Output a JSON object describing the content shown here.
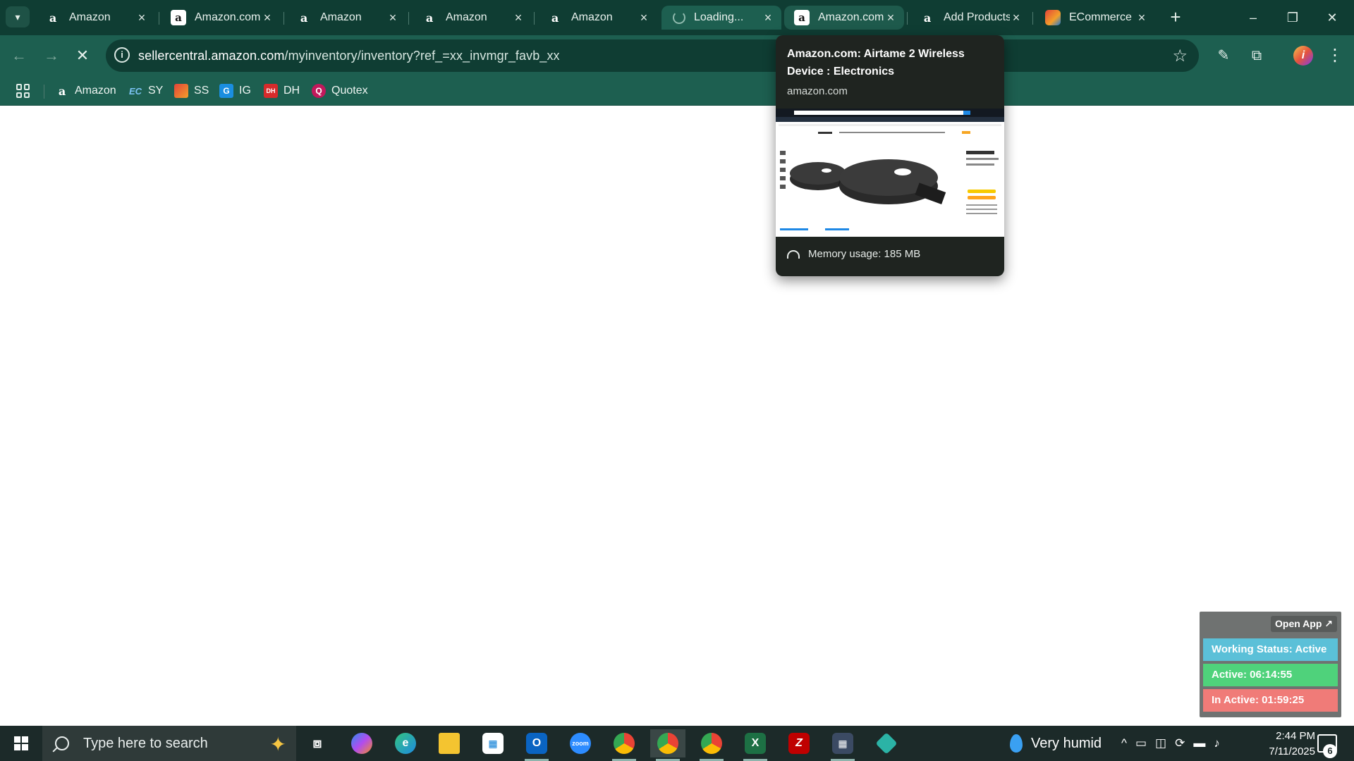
{
  "tabs": [
    {
      "title": "Amazon",
      "favicon": "amazon-icon"
    },
    {
      "title": "Amazon.com",
      "favicon": "amazon-icon"
    },
    {
      "title": "Amazon",
      "favicon": "amazon-icon"
    },
    {
      "title": "Amazon",
      "favicon": "amazon-icon"
    },
    {
      "title": "Amazon",
      "favicon": "amazon-icon"
    },
    {
      "title": "Loading...",
      "favicon": "loading-spinner"
    },
    {
      "title": "Amazon.com",
      "favicon": "amazon-icon"
    },
    {
      "title": "Add Products",
      "favicon": "amazon-icon"
    },
    {
      "title": "ECommerce",
      "favicon": "ecommerce-icon"
    }
  ],
  "window_controls": {
    "minimize": "–",
    "restore": "❐",
    "close": "✕"
  },
  "address_bar": {
    "host": "sellercentral.amazon.com",
    "path": "/myinventory/inventory?ref_=xx_invmgr_favb_xx"
  },
  "bookmarks": [
    {
      "label": "Amazon",
      "icon": "amazon-icon"
    },
    {
      "label": "SY",
      "icon": "ec-icon"
    },
    {
      "label": "SS",
      "icon": "ss-icon"
    },
    {
      "label": "IG",
      "icon": "ig-icon"
    },
    {
      "label": "DH",
      "icon": "dh-icon"
    },
    {
      "label": "Quotex",
      "icon": "quotex-icon"
    }
  ],
  "hover_card": {
    "title": "Amazon.com: Airtame 2 Wireless Device : Electronics",
    "domain": "amazon.com",
    "memory": "Memory usage: 185 MB"
  },
  "widget": {
    "open_app": "Open App ↗",
    "working_status": "Working Status: Active",
    "active": "Active: 06:14:55",
    "inactive": "In Active: 01:59:25"
  },
  "taskbar": {
    "search_placeholder": "Type here to search",
    "weather": "Very humid",
    "time": "2:44 PM",
    "date": "7/11/2025",
    "notification_count": "6"
  },
  "colors": {
    "tab_strip": "#0f3d33",
    "toolbar": "#1d5f50",
    "status_active": "#5bc0d8",
    "active_timer": "#4fd27b",
    "inactive_timer": "#f07b78"
  }
}
